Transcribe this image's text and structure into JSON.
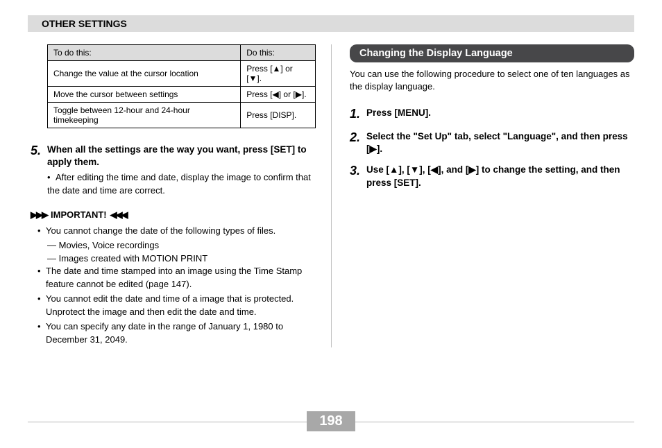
{
  "header": "OTHER SETTINGS",
  "table": {
    "head_left": "To do this:",
    "head_right": "Do this:",
    "rows": [
      {
        "left": "Change the value at the cursor location",
        "right": "Press [▲] or [▼]."
      },
      {
        "left": "Move the cursor between settings",
        "right": "Press [◀] or [▶]."
      },
      {
        "left": "Toggle between 12-hour and 24-hour timekeeping",
        "right": "Press [DISP]."
      }
    ]
  },
  "left_step": {
    "num": "5.",
    "text": "When all the settings are the way you want, press [SET] to apply them.",
    "sub": "After editing the time and date, display the image to confirm that the date and time are correct."
  },
  "important_label": "IMPORTANT!",
  "important_notes": [
    "You cannot change the date of the following types of files.",
    "— Movies, Voice recordings",
    "— Images created with MOTION PRINT",
    "The date and time stamped into an image using the Time Stamp feature cannot be edited (page 147).",
    "You cannot edit the date and time of a image that is protected. Unprotect the image and then edit the date and time.",
    "You can specify any date in the range of January 1, 1980 to December 31, 2049."
  ],
  "right_section": {
    "title": "Changing the Display Language",
    "intro": "You can use the following procedure to select one of ten languages as the display language.",
    "steps": [
      {
        "num": "1.",
        "text": "Press [MENU]."
      },
      {
        "num": "2.",
        "text": "Select the \"Set Up\" tab, select \"Language\", and then press [▶]."
      },
      {
        "num": "3.",
        "text": "Use [▲], [▼], [◀], and [▶] to change the setting, and then press [SET]."
      }
    ]
  },
  "page_number": "198"
}
